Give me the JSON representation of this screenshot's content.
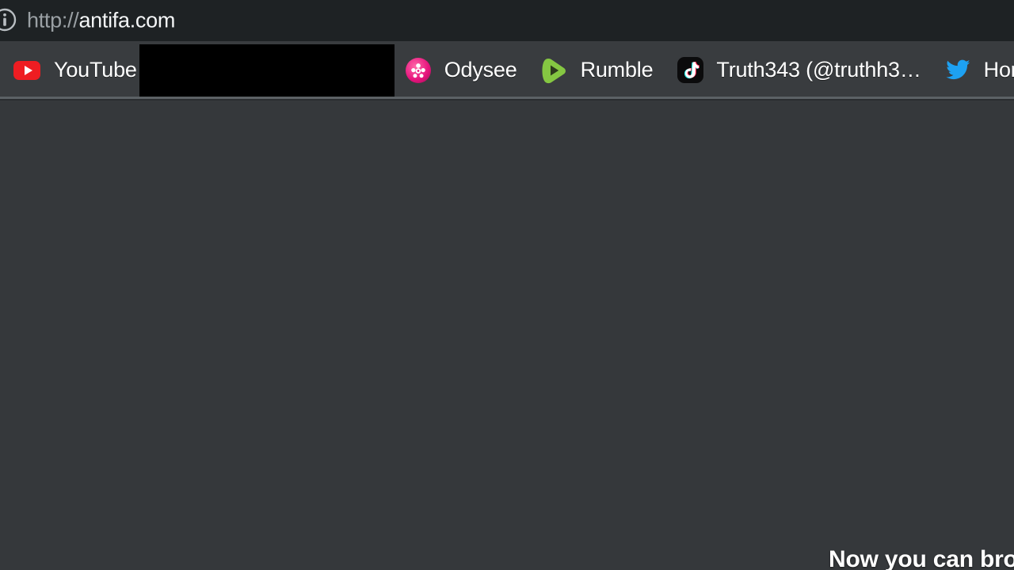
{
  "browser": {
    "url_bar": {
      "security_icon": "info-circle-icon",
      "scheme": "http://",
      "host": "antifa.com",
      "full_url": "http://antifa.com"
    },
    "bookmarks_bar": {
      "items": [
        {
          "label": "YouTube",
          "icon": "youtube-icon",
          "redacted": false
        },
        {
          "label": "",
          "icon": "redacted-icon",
          "redacted": true
        },
        {
          "label": "Odysee",
          "icon": "odysee-icon",
          "redacted": false
        },
        {
          "label": "Rumble",
          "icon": "rumble-icon",
          "redacted": false
        },
        {
          "label": "Truth343 (@truthh3…",
          "icon": "tiktok-icon",
          "redacted": false
        },
        {
          "label": "Home",
          "icon": "twitter-icon",
          "redacted": false
        }
      ]
    }
  },
  "page": {
    "bottom_caption": "Now you can brow"
  },
  "colors": {
    "urlbar_background": "#1e2224",
    "bookmarks_background": "#393c3f",
    "page_background": "#35383b",
    "separator": "#5c6165",
    "redaction": "#000000",
    "youtube_red": "#ee1d22",
    "odysee_pink": "#e6147d",
    "rumble_green": "#85c742",
    "tiktok_black": "#0b0b0c",
    "twitter_blue": "#1da1f2",
    "text_primary": "#ffffff",
    "text_muted": "#9aa0a4"
  }
}
